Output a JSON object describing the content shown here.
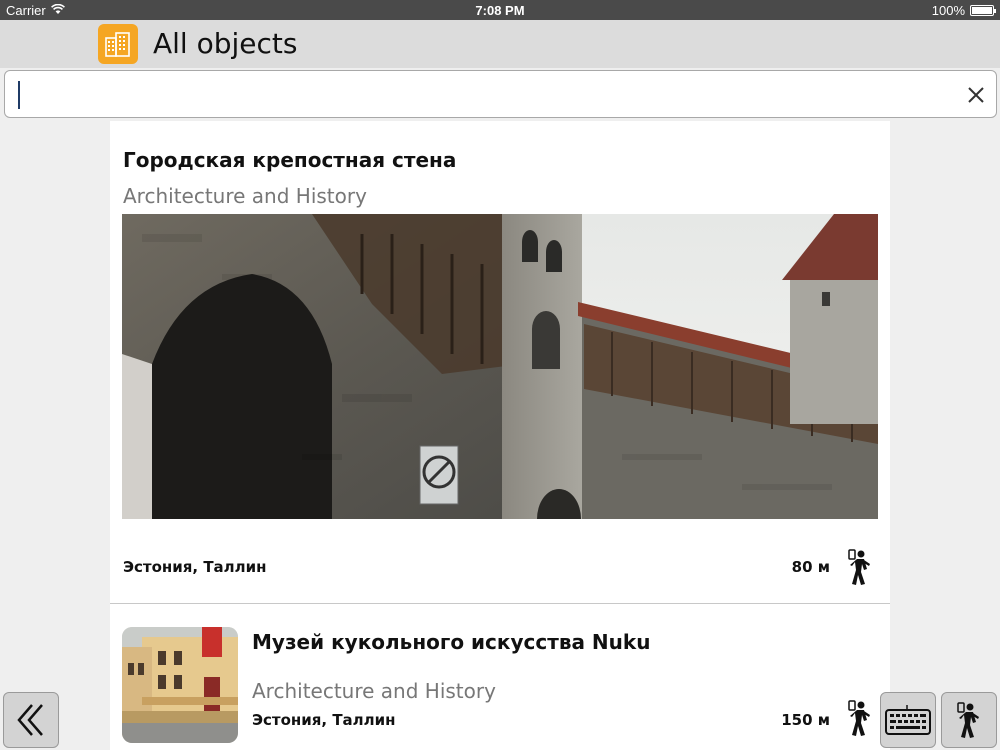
{
  "status_bar": {
    "carrier": "Carrier",
    "time": "7:08 PM",
    "battery": "100%"
  },
  "header": {
    "title": "All objects",
    "icon": "buildings-icon",
    "accent_color": "#f5a623"
  },
  "search": {
    "value": "",
    "clear_icon": "close-icon"
  },
  "items": [
    {
      "title": "Городская крепостная стена",
      "category": "Architecture and History",
      "location": "Эстония, Таллин",
      "distance": "80 м",
      "mode_icon": "pedestrian-icon"
    },
    {
      "title": "Музей кукольного искусства Nuku",
      "category": "Architecture and History",
      "location": "Эстония, Таллин",
      "distance": "150 м",
      "mode_icon": "pedestrian-icon"
    }
  ],
  "toolbar": {
    "back_icon": "double-chevron-left-icon",
    "keyboard_icon": "keyboard-icon",
    "walk_icon": "pedestrian-icon"
  }
}
